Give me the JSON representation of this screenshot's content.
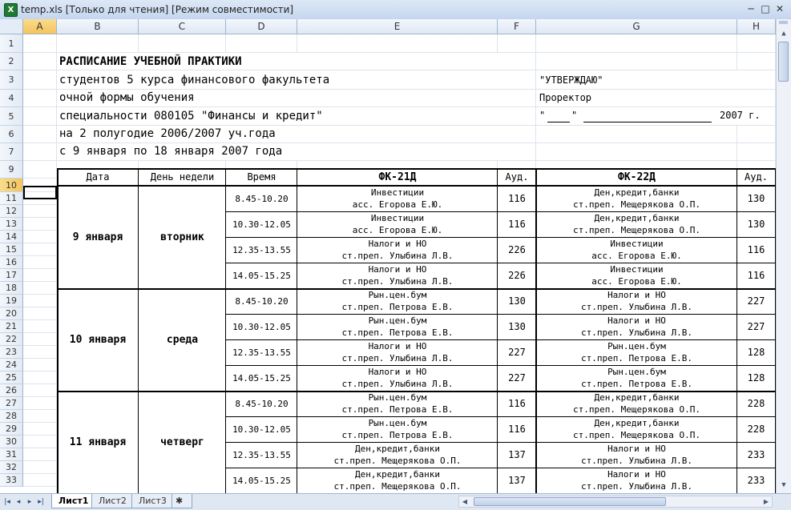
{
  "window": {
    "title": "temp.xls  [Только для чтения]  [Режим совместимости]",
    "icon": "excel-icon",
    "minimize": "─",
    "maximize": "□",
    "close": "✕"
  },
  "columns": [
    "A",
    "B",
    "C",
    "D",
    "E",
    "F",
    "G",
    "H"
  ],
  "rows": [
    "1",
    "2",
    "3",
    "4",
    "5",
    "6",
    "7",
    "9",
    "10",
    "11",
    "12",
    "13",
    "14",
    "15",
    "16",
    "17",
    "18",
    "19",
    "20",
    "21",
    "22",
    "23",
    "24",
    "25",
    "26",
    "27",
    "28",
    "29",
    "30",
    "31",
    "32",
    "33"
  ],
  "header_text": {
    "title": "РАСПИСАНИЕ УЧЕБНОЙ ПРАКТИКИ",
    "line3": "студентов 5 курса финансового факультета",
    "line4": "очной формы обучения",
    "line5": "специальности 080105 \"Финансы и кредит\"",
    "line6": "на 2 полугодие 2006/2007 уч.года",
    "line7": "с 9 января по 18 января 2007 года",
    "approve": "\"УТВЕРЖДАЮ\"",
    "prorector": "Проректор",
    "date_quote_open": "\"",
    "date_quote_close": "\"",
    "year": "2007 г."
  },
  "table": {
    "headers": {
      "date": "Дата",
      "weekday": "День недели",
      "time": "Время",
      "group1": "ФК-21Д",
      "aud1": "Ауд.",
      "group2": "ФК-22Д",
      "aud2": "Ауд."
    },
    "days": [
      {
        "date": "9 января",
        "weekday": "вторник",
        "slots": [
          {
            "time": "8.45-10.20",
            "g1_subject": "Инвестиции",
            "g1_teacher": "асс. Егорова Е.Ю.",
            "aud1": "116",
            "g2_subject": "Ден,кредит,банки",
            "g2_teacher": "ст.преп. Мещерякова О.П.",
            "aud2": "130"
          },
          {
            "time": "10.30-12.05",
            "g1_subject": "Инвестиции",
            "g1_teacher": "асс. Егорова Е.Ю.",
            "aud1": "116",
            "g2_subject": "Ден,кредит,банки",
            "g2_teacher": "ст.преп. Мещерякова О.П.",
            "aud2": "130"
          },
          {
            "time": "12.35-13.55",
            "g1_subject": "Налоги и НО",
            "g1_teacher": "ст.преп. Улыбина Л.В.",
            "aud1": "226",
            "g2_subject": "Инвестиции",
            "g2_teacher": "асс. Егорова Е.Ю.",
            "aud2": "116"
          },
          {
            "time": "14.05-15.25",
            "g1_subject": "Налоги и НО",
            "g1_teacher": "ст.преп. Улыбина Л.В.",
            "aud1": "226",
            "g2_subject": "Инвестиции",
            "g2_teacher": "асс. Егорова Е.Ю.",
            "aud2": "116"
          }
        ]
      },
      {
        "date": "10 января",
        "weekday": "среда",
        "slots": [
          {
            "time": "8.45-10.20",
            "g1_subject": "Рын.цен.бум",
            "g1_teacher": "ст.преп. Петрова Е.В.",
            "aud1": "130",
            "g2_subject": "Налоги и НО",
            "g2_teacher": "ст.преп. Улыбина Л.В.",
            "aud2": "227"
          },
          {
            "time": "10.30-12.05",
            "g1_subject": "Рын.цен.бум",
            "g1_teacher": "ст.преп. Петрова Е.В.",
            "aud1": "130",
            "g2_subject": "Налоги и НО",
            "g2_teacher": "ст.преп. Улыбина Л.В.",
            "aud2": "227"
          },
          {
            "time": "12.35-13.55",
            "g1_subject": "Налоги и НО",
            "g1_teacher": "ст.преп. Улыбина Л.В.",
            "aud1": "227",
            "g2_subject": "Рын.цен.бум",
            "g2_teacher": "ст.преп. Петрова Е.В.",
            "aud2": "128"
          },
          {
            "time": "14.05-15.25",
            "g1_subject": "Налоги и НО",
            "g1_teacher": "ст.преп. Улыбина Л.В.",
            "aud1": "227",
            "g2_subject": "Рын.цен.бум",
            "g2_teacher": "ст.преп. Петрова Е.В.",
            "aud2": "128"
          }
        ]
      },
      {
        "date": "11 января",
        "weekday": "четверг",
        "slots": [
          {
            "time": "8.45-10.20",
            "g1_subject": "Рын.цен.бум",
            "g1_teacher": "ст.преп. Петрова Е.В.",
            "aud1": "116",
            "g2_subject": "Ден,кредит,банки",
            "g2_teacher": "ст.преп. Мещерякова О.П.",
            "aud2": "228"
          },
          {
            "time": "10.30-12.05",
            "g1_subject": "Рын.цен.бум",
            "g1_teacher": "ст.преп. Петрова Е.В.",
            "aud1": "116",
            "g2_subject": "Ден,кредит,банки",
            "g2_teacher": "ст.преп. Мещерякова О.П.",
            "aud2": "228"
          },
          {
            "time": "12.35-13.55",
            "g1_subject": "Ден,кредит,банки",
            "g1_teacher": "ст.преп. Мещерякова О.П.",
            "aud1": "137",
            "g2_subject": "Налоги и НО",
            "g2_teacher": "ст.преп. Улыбина Л.В.",
            "aud2": "233"
          },
          {
            "time": "14.05-15.25",
            "g1_subject": "Ден,кредит,банки",
            "g1_teacher": "ст.преп. Мещерякова О.П.",
            "aud1": "137",
            "g2_subject": "Налоги и НО",
            "g2_teacher": "ст.преп. Улыбина Л.В.",
            "aud2": "233"
          }
        ]
      }
    ]
  },
  "sheets": [
    "Лист1",
    "Лист2",
    "Лист3"
  ],
  "active_sheet": "Лист1",
  "selected_cell": "A10",
  "nav_buttons": [
    "|◂",
    "◂",
    "▸",
    "▸|"
  ]
}
